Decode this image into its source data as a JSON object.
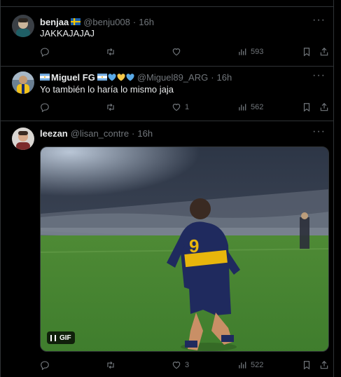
{
  "tweets": [
    {
      "name": "benjaa",
      "handle": "@benju008",
      "time": "16h",
      "text": "JAKKAJAJAJ",
      "replies": "",
      "retweets": "",
      "likes": "",
      "views": "593",
      "flag": "sweden-flag-icon"
    },
    {
      "name": "Miguel FG",
      "handle": "@Miguel89_ARG",
      "time": "16h",
      "text": "Yo también lo haría lo mismo jaja",
      "replies": "",
      "retweets": "",
      "likes": "1",
      "views": "562",
      "flag": "argentina-flag-icon"
    },
    {
      "name": "leezan",
      "handle": "@lisan_contre",
      "time": "16h",
      "text": "",
      "replies": "",
      "retweets": "",
      "likes": "3",
      "views": "522",
      "media": {
        "type": "GIF",
        "label": "GIF",
        "description_icon": "football-player-gif"
      }
    }
  ],
  "separator": "·",
  "more_glyph": "···",
  "colors": {
    "background": "#000000",
    "text": "#e7e9ea",
    "muted": "#71767b",
    "border": "#2f3336",
    "heart_blue": "#5aa9e6",
    "heart_yellow": "#f4c84a"
  }
}
